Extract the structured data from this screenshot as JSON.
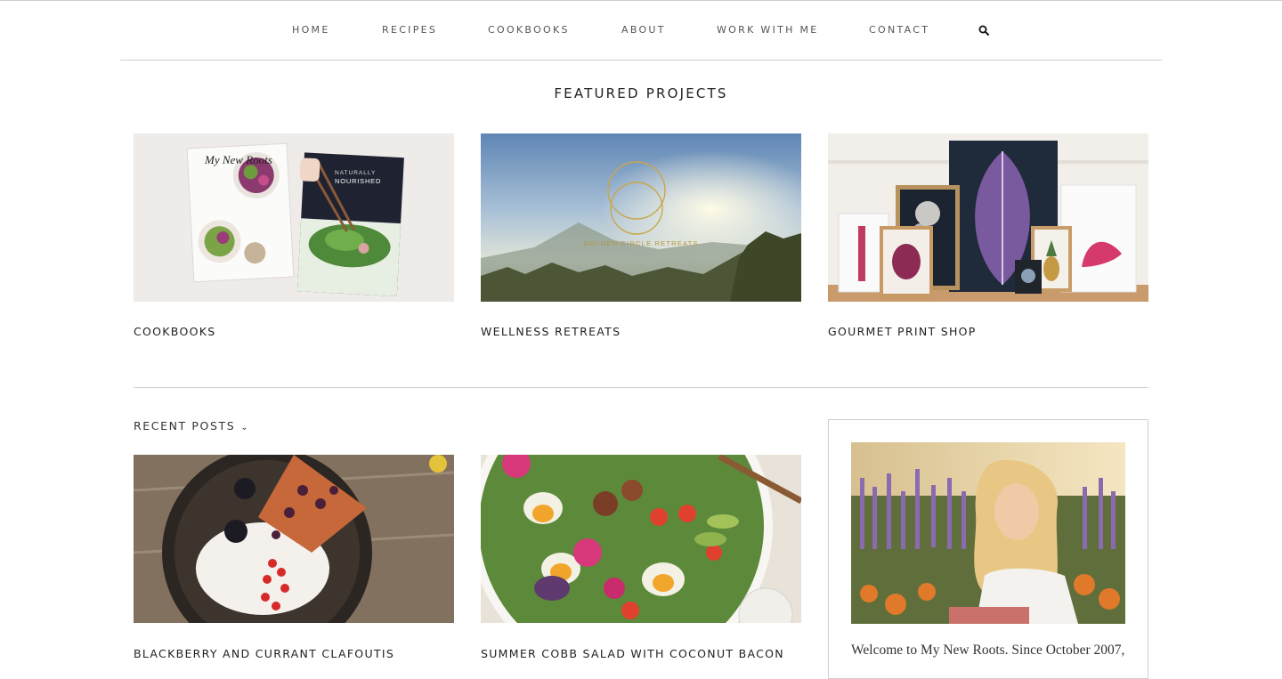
{
  "nav": {
    "items": [
      "HOME",
      "RECIPES",
      "COOKBOOKS",
      "ABOUT",
      "WORK WITH ME",
      "CONTACT"
    ],
    "search_icon": "search-icon"
  },
  "featured": {
    "title": "FEATURED PROJECTS",
    "cards": [
      {
        "label": "COOKBOOKS",
        "image": "cookbooks-photo",
        "book1_title": "My New Roots",
        "book2_title_top": "NATURALLY",
        "book2_title": "NOURISHED"
      },
      {
        "label": "WELLNESS RETREATS",
        "image": "retreat-photo",
        "overlay_text": "GOLDEN CIRCLE RETREATS"
      },
      {
        "label": "GOURMET PRINT SHOP",
        "image": "print-shop-photo"
      }
    ]
  },
  "recent": {
    "label": "RECENT POSTS",
    "chevron_icon": "chevron-down-icon",
    "posts": [
      {
        "title": "BLACKBERRY AND CURRANT CLAFOUTIS",
        "image": "clafoutis-photo"
      },
      {
        "title": "SUMMER COBB SALAD WITH COCONUT BACON",
        "image": "cobb-salad-photo"
      }
    ]
  },
  "sidebar": {
    "image": "author-portrait-photo",
    "welcome_text": "Welcome to My New Roots. Since October 2007,"
  },
  "colors": {
    "text": "#222222",
    "nav_text": "#555555",
    "rule": "#cfcfcf",
    "gold": "#c9a64a"
  }
}
